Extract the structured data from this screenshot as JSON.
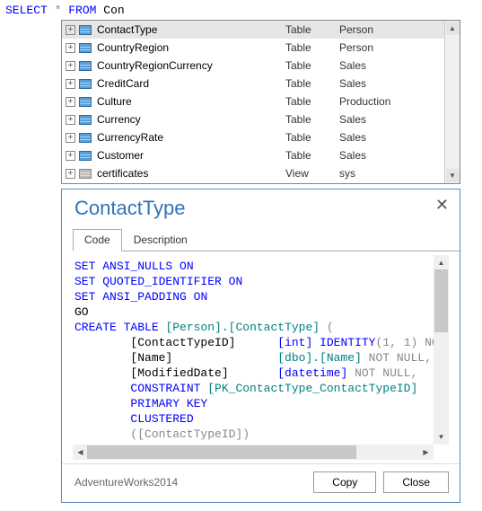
{
  "query": {
    "kw1": "SELECT",
    "star": "*",
    "kw2": "FROM",
    "typed": "Con"
  },
  "completion": {
    "items": [
      {
        "name": "ContactType",
        "type": "Table",
        "schema": "Person",
        "icon": "table",
        "selected": true
      },
      {
        "name": "CountryRegion",
        "type": "Table",
        "schema": "Person",
        "icon": "table",
        "selected": false
      },
      {
        "name": "CountryRegionCurrency",
        "type": "Table",
        "schema": "Sales",
        "icon": "table",
        "selected": false
      },
      {
        "name": "CreditCard",
        "type": "Table",
        "schema": "Sales",
        "icon": "table",
        "selected": false
      },
      {
        "name": "Culture",
        "type": "Table",
        "schema": "Production",
        "icon": "table",
        "selected": false
      },
      {
        "name": "Currency",
        "type": "Table",
        "schema": "Sales",
        "icon": "table",
        "selected": false
      },
      {
        "name": "CurrencyRate",
        "type": "Table",
        "schema": "Sales",
        "icon": "table",
        "selected": false
      },
      {
        "name": "Customer",
        "type": "Table",
        "schema": "Sales",
        "icon": "table",
        "selected": false
      },
      {
        "name": "certificates",
        "type": "View",
        "schema": "sys",
        "icon": "view",
        "selected": false
      }
    ]
  },
  "detail": {
    "title": "ContactType",
    "tabs": {
      "code": "Code",
      "description": "Description"
    },
    "code": {
      "l1a": "SET",
      "l1b": "ANSI_NULLS",
      "l1c": "ON",
      "l2a": "SET",
      "l2b": "QUOTED_IDENTIFIER",
      "l2c": "ON",
      "l3a": "SET",
      "l3b": "ANSI_PADDING",
      "l3c": "ON",
      "l4": "GO",
      "l5a": "CREATE",
      "l5b": "TABLE",
      "l5c": "[Person].[ContactType]",
      "l5d": "(",
      "l6a": "        [ContactTypeID]      ",
      "l6b": "[int]",
      "l6c": " IDENTITY",
      "l6d": "(1, 1)",
      "l6e": " NOT",
      "l7a": "        [Name]               ",
      "l7b": "[dbo].[Name]",
      "l7c": " NOT NULL,",
      "l8a": "        [ModifiedDate]       ",
      "l8b": "[datetime]",
      "l8c": " NOT NULL,",
      "l9a": "        ",
      "l9b": "CONSTRAINT",
      "l9c": " [PK_ContactType_ContactTypeID]",
      "l10": "        PRIMARY KEY",
      "l11": "        CLUSTERED",
      "l12": "        ([ContactTypeID])"
    },
    "db": "AdventureWorks2014",
    "buttons": {
      "copy": "Copy",
      "close": "Close"
    }
  }
}
